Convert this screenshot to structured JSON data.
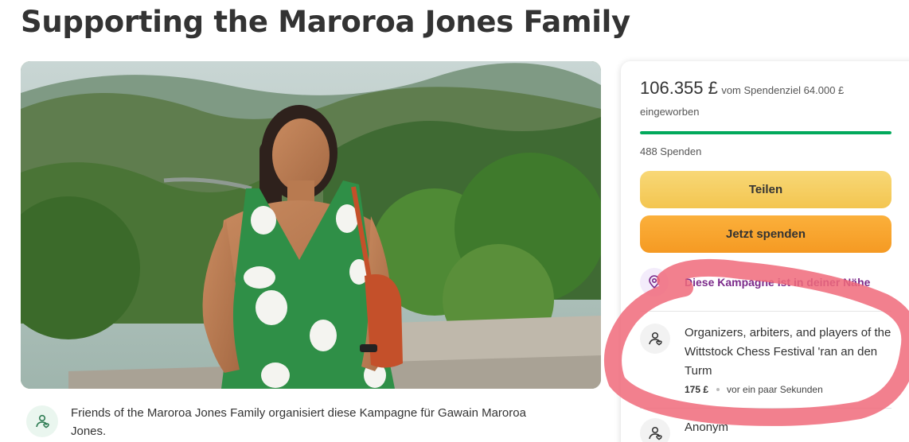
{
  "campaign": {
    "title": "Supporting the Maroroa Jones Family",
    "organizer_text": "Friends of the Maroroa Jones Family organisiert diese Kampagne für Gawain Maroroa Jones."
  },
  "donation": {
    "amount": "106.355 £",
    "goal_text": "vom Spendenziel 64.000 £",
    "raised_label": "eingeworben",
    "progress_percent": 100,
    "donations_count": "488 Spenden",
    "share_label": "Teilen",
    "donate_label": "Jetzt spenden",
    "nearby_text": "Diese Kampagne ist in deiner Nähe"
  },
  "donors": [
    {
      "name": "Organizers, arbiters, and players of the Wittstock Chess Festival 'ran an den Turm",
      "amount": "175 £",
      "time": "vor ein paar Sekunden"
    },
    {
      "name": "Anonym"
    }
  ],
  "icons": {
    "organizer": "heart-hand-icon",
    "nearby": "location-pin-icon",
    "donor": "heart-hand-icon"
  },
  "colors": {
    "progress": "#02a95c",
    "share_button": "#f3c550",
    "donate_button": "#f59a23",
    "nearby_text": "#7b2a8a",
    "annotation": "#f06a7a"
  }
}
